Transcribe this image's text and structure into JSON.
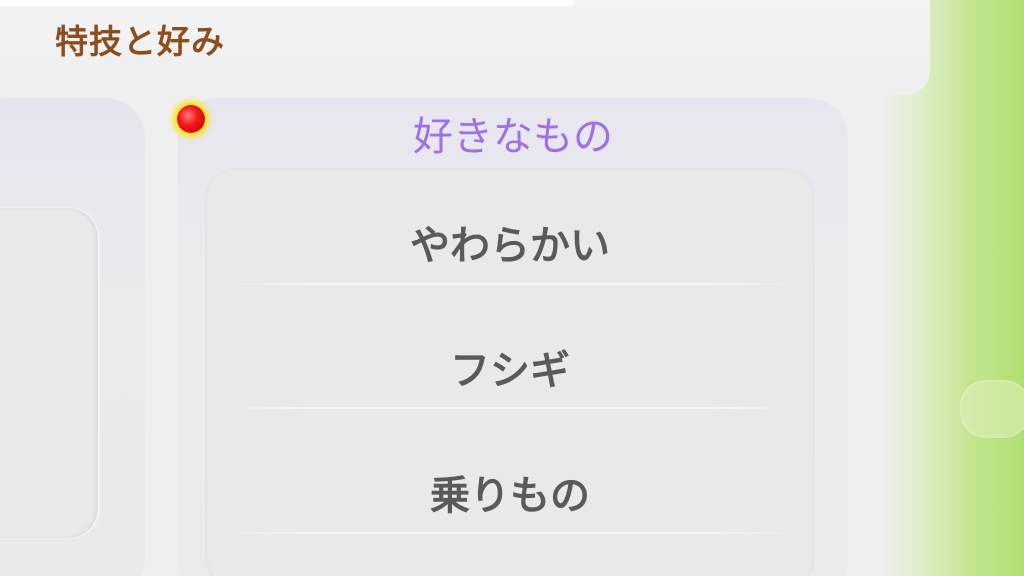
{
  "section": {
    "title": "特技と好み"
  },
  "list": {
    "header": "好きなもの",
    "items": [
      {
        "label": "やわらかい"
      },
      {
        "label": "フシギ"
      },
      {
        "label": "乗りもの"
      }
    ]
  },
  "colors": {
    "title": "#8b4f1d",
    "header_accent": "#a071e6",
    "item_text": "#5a5a5a",
    "background_green": "#b2df72",
    "pointer": "#f01818"
  },
  "icons": {
    "pointer": "red-dot-cursor-icon"
  }
}
